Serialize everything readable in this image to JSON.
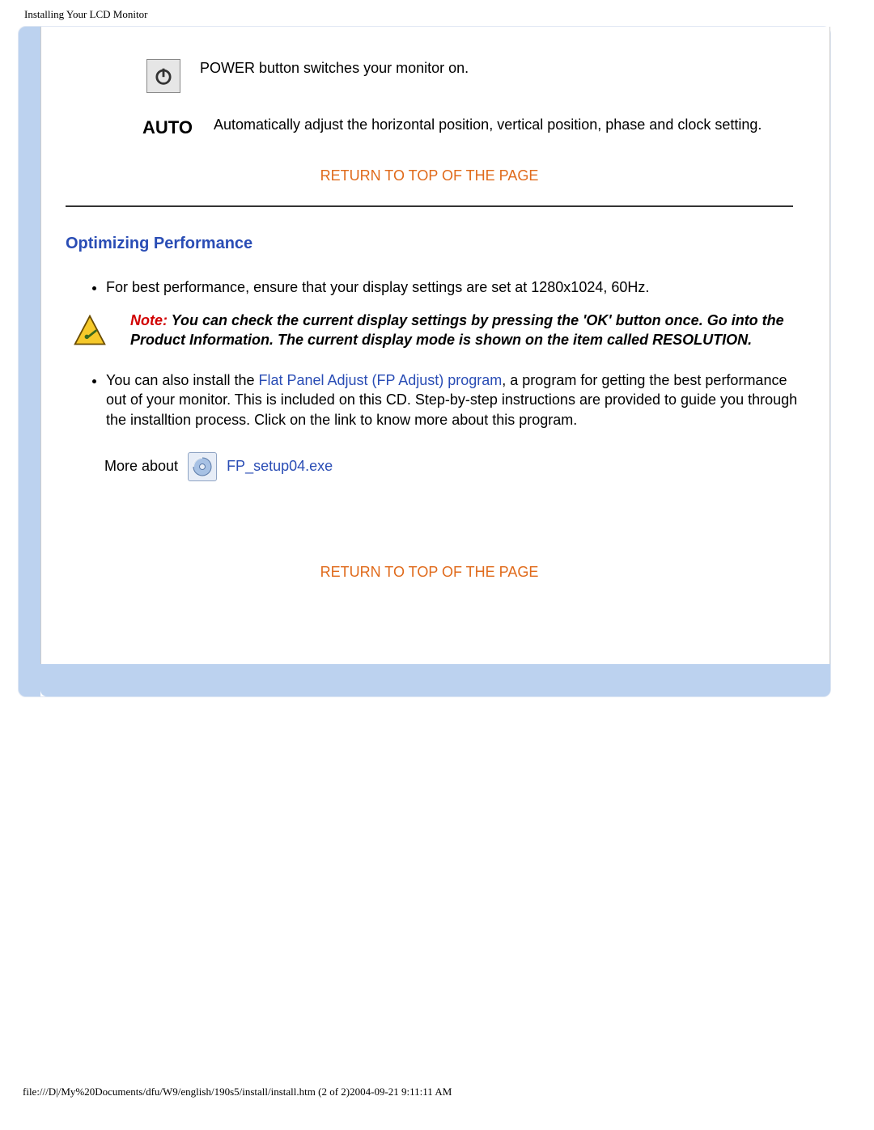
{
  "page_header": "Installing Your LCD Monitor",
  "row_power_text": "POWER button switches your monitor on.",
  "row_auto_label": "AUTO",
  "row_auto_text": "Automatically adjust the horizontal position, vertical position, phase and clock setting.",
  "return_top": "RETURN TO TOP OF THE PAGE",
  "section_heading": "Optimizing Performance",
  "bullet1": "For best performance, ensure that your display settings are set at 1280x1024, 60Hz.",
  "note_label": "Note:",
  "note_body": " You can check the current display settings by pressing the 'OK' button once. Go into the Product Information. The current display mode is shown on the item called RESOLUTION.",
  "bullet2_lead": "You can also install the ",
  "fp_link_text": "Flat Panel Adjust (FP Adjust) program",
  "bullet2_rest": ", a program for getting the best performance out of your monitor. This is included on this CD. Step-by-step instructions are provided to guide you through the installtion process. Click on the link to know more about this program.",
  "more_about": "More about",
  "fp_exe": "FP_setup04.exe",
  "footer_path": "file:///D|/My%20Documents/dfu/W9/english/190s5/install/install.htm (2 of 2)2004-09-21 9:11:11 AM"
}
